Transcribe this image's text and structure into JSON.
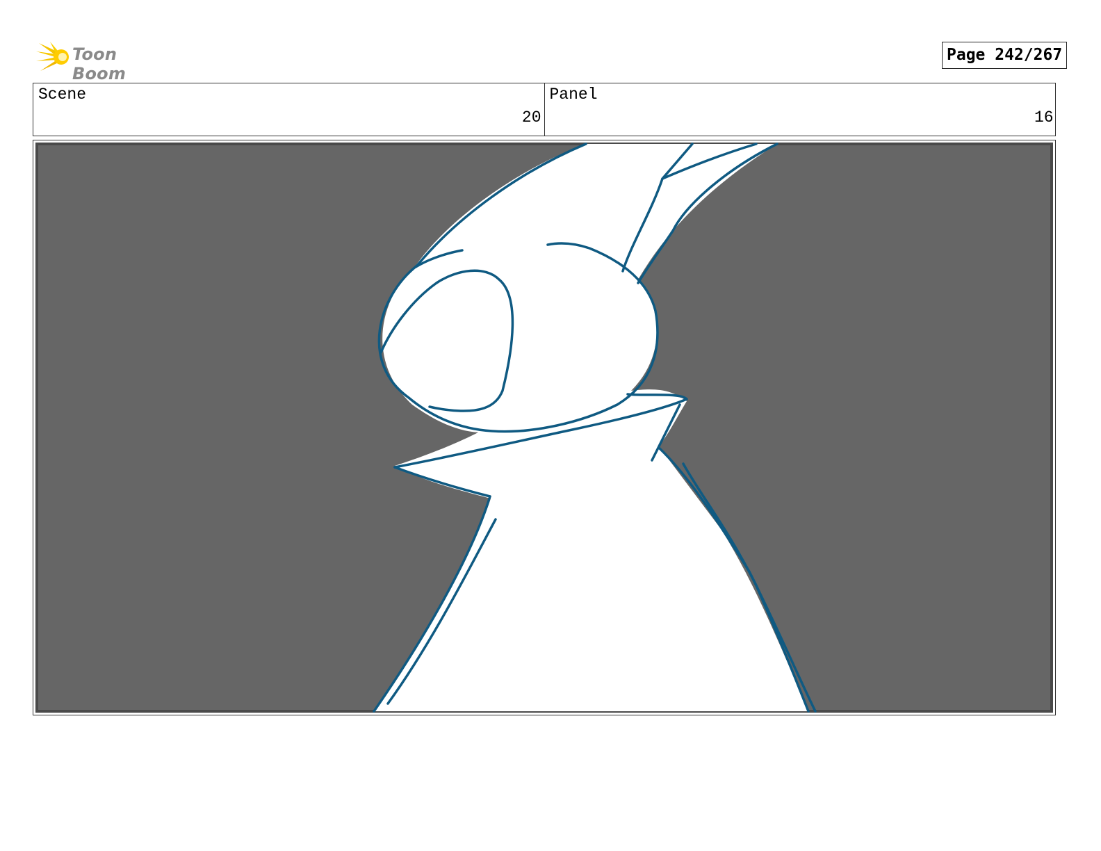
{
  "header": {
    "logo_text": "Toon Boom",
    "page_label": "Page 242/267"
  },
  "info": {
    "scene_label": "Scene",
    "scene_value": "20",
    "panel_label": "Panel",
    "panel_value": "16"
  },
  "colors": {
    "background_gray": "#666666",
    "sketch_line": "#0f5a82",
    "logo_yellow": "#f5c400",
    "logo_text_gray": "#8a8a8a"
  }
}
